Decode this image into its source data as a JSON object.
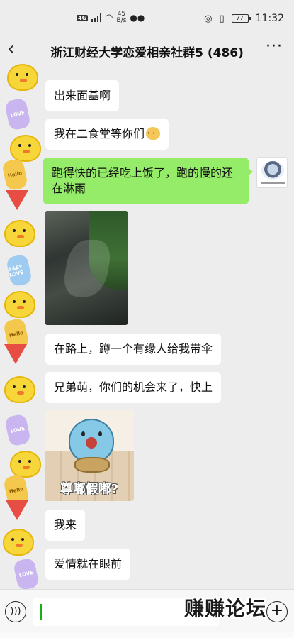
{
  "status_bar": {
    "network_label": "4G",
    "speed_value": "45",
    "speed_unit": "B/s",
    "battery_level": "77",
    "time": "11:32"
  },
  "header": {
    "title": "浙江财经大学恋爱相亲社群5 (486)",
    "back_icon": "chevron-left-icon",
    "more_icon": "ellipsis-icon"
  },
  "messages": [
    {
      "type": "text",
      "text": "出来面基啊"
    },
    {
      "type": "text",
      "text": "我在二食堂等你们"
    },
    {
      "type": "text",
      "mine": true,
      "text": "跑得快的已经吃上饭了，跑的慢的还在淋雨"
    },
    {
      "type": "image",
      "description": "rainy road photo"
    },
    {
      "type": "text",
      "text": "在路上，蹲一个有缘人给我带伞"
    },
    {
      "type": "text",
      "text": "兄弟萌，你们的机会来了，快上"
    },
    {
      "type": "sticker",
      "caption": "尊嘟假嘟?"
    },
    {
      "type": "text",
      "text": "我来"
    },
    {
      "type": "text",
      "text": "爱情就在眼前"
    }
  ],
  "stickers": {
    "love": "LOVE",
    "hello": "Hello",
    "baby": "BABY LOVE"
  },
  "input_bar": {
    "voice_icon": "voice-icon",
    "input_value": "",
    "plus_icon": "plus-icon"
  },
  "watermark": "赚赚论坛"
}
